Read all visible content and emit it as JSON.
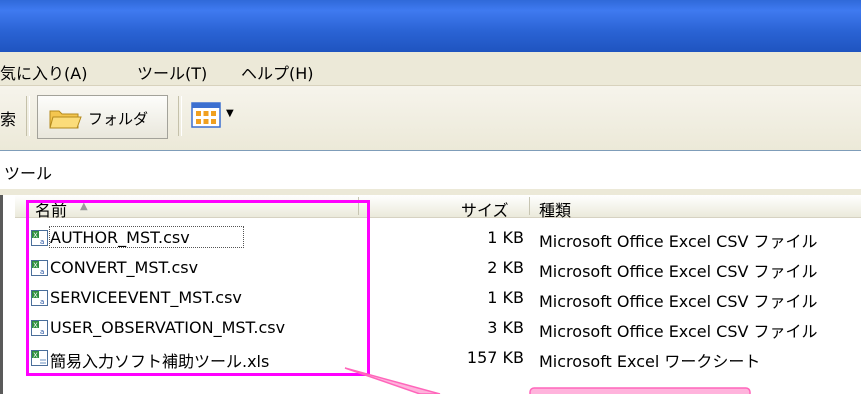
{
  "menubar": {
    "items": [
      {
        "label": "気に入り(A)"
      },
      {
        "label": "ツール(T)"
      },
      {
        "label": "ヘルプ(H)"
      }
    ]
  },
  "toolbar": {
    "search_label": "索",
    "folders_label": "フォルダ"
  },
  "address": {
    "value": "ツール"
  },
  "file_list": {
    "columns": [
      "名前",
      "サイズ",
      "種類"
    ],
    "rows": [
      {
        "name": "AUTHOR_MST.csv",
        "size": "1 KB",
        "type": "Microsoft Office Excel CSV ファイル"
      },
      {
        "name": "CONVERT_MST.csv",
        "size": "2 KB",
        "type": "Microsoft Office Excel CSV ファイル"
      },
      {
        "name": "SERVICEEVENT_MST.csv",
        "size": "1 KB",
        "type": "Microsoft Office Excel CSV ファイル"
      },
      {
        "name": "USER_OBSERVATION_MST.csv",
        "size": "3 KB",
        "type": "Microsoft Office Excel CSV ファイル"
      },
      {
        "name": "簡易入力ソフト補助ツール.xls",
        "size": "157 KB",
        "type": "Microsoft Excel ワークシート"
      }
    ]
  },
  "icons": {
    "folder": "folder-icon",
    "views": "views-grid-icon",
    "csv_file": "excel-csv-file-icon",
    "xls_file": "excel-xls-file-icon"
  },
  "colors": {
    "titlebar": "#2a63d4",
    "annotation": "#ff00ff",
    "callout": "#ff88cc"
  }
}
